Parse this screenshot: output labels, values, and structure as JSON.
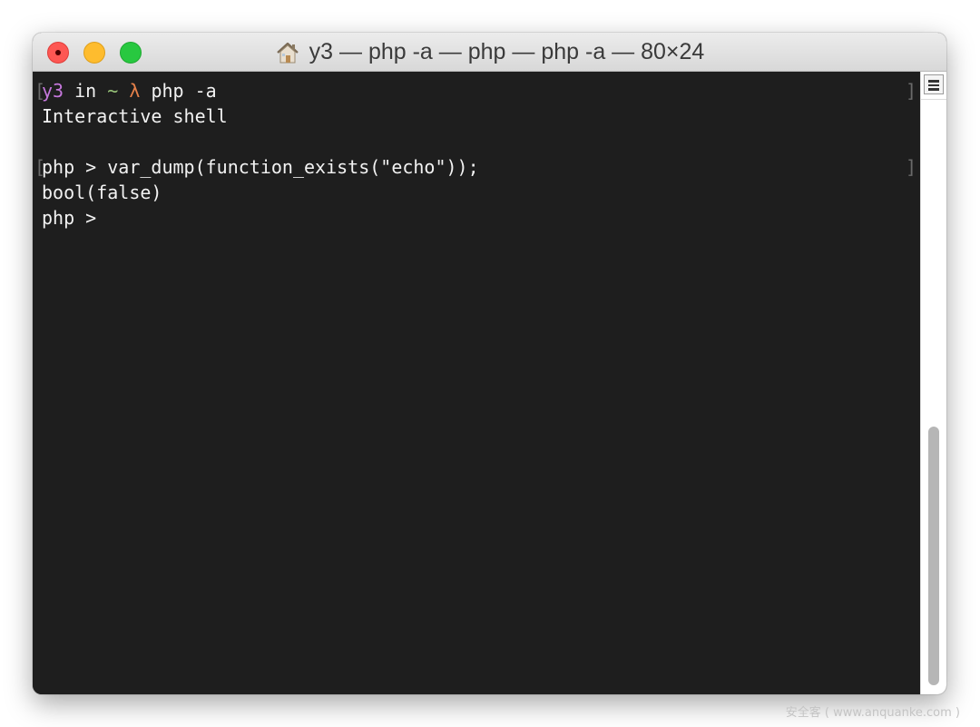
{
  "window": {
    "title": "y3 — php -a — php — php -a — 80×24",
    "title_icon": "home-icon",
    "buttons": {
      "close": "close-button",
      "minimize": "minimize-button",
      "zoom": "zoom-button"
    }
  },
  "terminal": {
    "prompt": {
      "user": "y3",
      "in": " in ",
      "dir": "~",
      "lambda": " λ ",
      "command": "php -a"
    },
    "lines": [
      "Interactive shell",
      "php > var_dump(function_exists(\"echo\"));",
      "bool(false)",
      "php > "
    ],
    "mark_left": "[",
    "mark_right": "]",
    "colors": {
      "background": "#1e1e1e",
      "foreground": "#f2f2f2",
      "user": "#c678dd",
      "tilde": "#98c379",
      "lambda": "#e5804a"
    }
  },
  "watermark": "安全客 ( www.anquanke.com )"
}
